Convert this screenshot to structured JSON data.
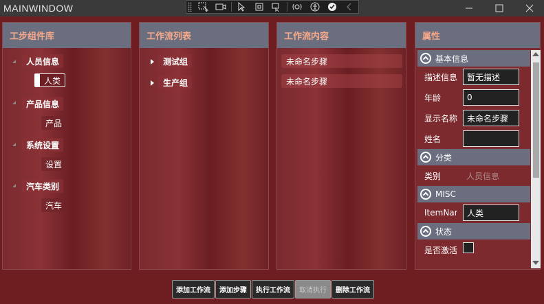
{
  "window": {
    "title": "MAINWINDOW"
  },
  "debug_toolbar": {
    "icons": [
      "select-element-icon",
      "video-icon",
      "pointer-icon",
      "frame-icon",
      "hot-reload-icon",
      "binding-icon",
      "accessibility-icon",
      "checkmark-icon",
      "collapse-icon"
    ]
  },
  "panels": {
    "components": {
      "title": "工步组件库",
      "groups": [
        {
          "label": "人员信息",
          "children": [
            "人类"
          ]
        },
        {
          "label": "产品信息",
          "children": [
            "产品"
          ]
        },
        {
          "label": "系统设置",
          "children": [
            "设置"
          ]
        },
        {
          "label": "汽车类别",
          "children": [
            "汽车"
          ]
        }
      ]
    },
    "workflow_list": {
      "title": "工作流列表",
      "groups": [
        "测试组",
        "生产组"
      ]
    },
    "workflow_content": {
      "title": "工作流内容",
      "steps": [
        "未命名步骤",
        "未命名步骤"
      ]
    },
    "properties": {
      "title": "属性",
      "categories": [
        {
          "name": "基本信息",
          "rows": [
            {
              "name": "描述信息",
              "value": "暂无描述"
            },
            {
              "name": "年龄",
              "value": "0"
            },
            {
              "name": "显示名称",
              "value": "未命名步骤"
            },
            {
              "name": "姓名",
              "value": ""
            }
          ]
        },
        {
          "name": "分类",
          "rows": [
            {
              "name": "类别",
              "value": "人员信息"
            }
          ]
        },
        {
          "name": "MISC",
          "rows": [
            {
              "name": "ItemName",
              "value": "人类"
            }
          ]
        },
        {
          "name": "状态",
          "rows": [
            {
              "name": "是否激活",
              "value": ""
            }
          ]
        }
      ]
    }
  },
  "buttons": {
    "add_workflow": "添加工作流",
    "add_step": "添加步骤",
    "run_workflow": "执行工作流",
    "cancel_run": "取消执行",
    "delete_workflow": "删除工作流"
  },
  "colors": {
    "background": "#6e1d21",
    "header_bg": "#6a6e7e",
    "header_text": "#f7a98a"
  }
}
